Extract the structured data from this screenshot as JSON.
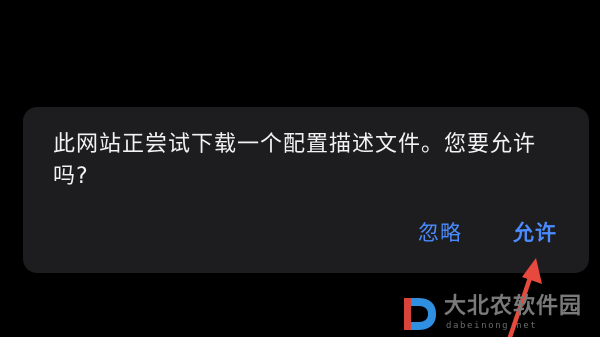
{
  "dialog": {
    "message": "此网站正尝试下载一个配置描述文件。您要允许吗?",
    "ignore_label": "忽略",
    "allow_label": "允许"
  },
  "watermark": {
    "name": "大北农软件园",
    "url": "dabeinong.net"
  },
  "colors": {
    "background": "#000000",
    "dialog_bg": "#1d1d1f",
    "button_text": "#4a8cff",
    "arrow": "#e8493f"
  }
}
